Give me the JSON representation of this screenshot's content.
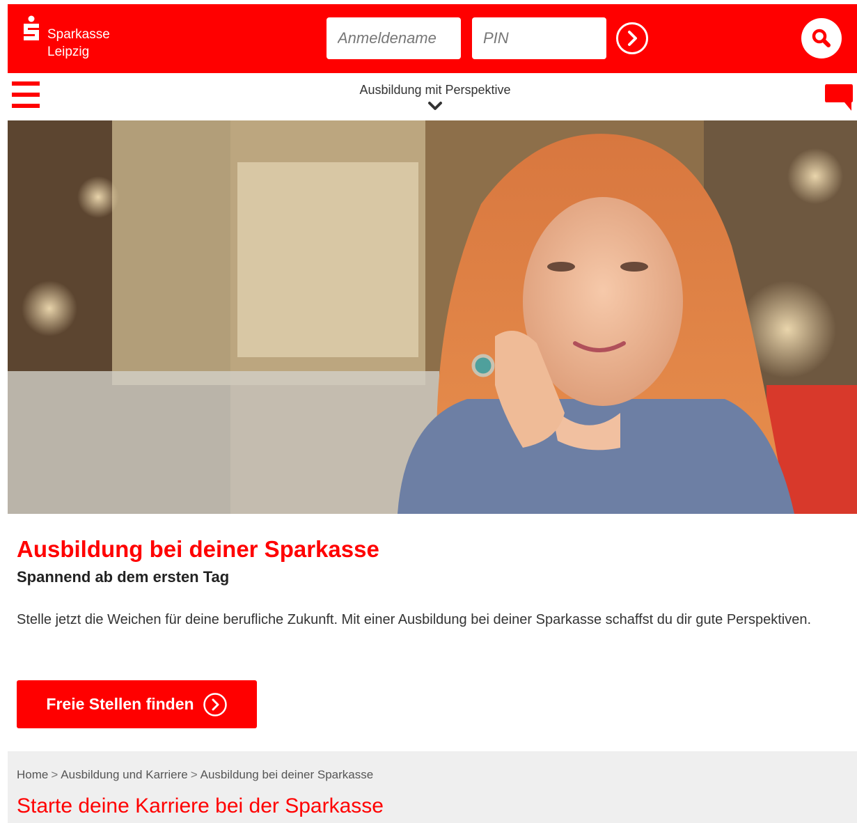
{
  "brand": {
    "name_line1": "Sparkasse",
    "name_line2": "Leipzig",
    "color": "#ff0000"
  },
  "login": {
    "username_placeholder": "Anmeldename",
    "pin_placeholder": "PIN",
    "submit_icon": "chevron-right-circle-icon"
  },
  "header": {
    "search_icon": "search-icon"
  },
  "subnav": {
    "menu_icon": "hamburger-menu-icon",
    "title": "Ausbildung mit Perspektive",
    "dropdown_icon": "chevron-down-icon",
    "chat_icon": "chat-bubble-icon"
  },
  "hero": {
    "image": "young woman with red hair resting chin on hand, smiling, blurred cafe background"
  },
  "content": {
    "headline": "Ausbildung bei deiner Sparkasse",
    "subheadline": "Spannend ab dem ersten Tag",
    "intro": "Stelle jetzt die Weichen für deine berufliche Zukunft. Mit einer Ausbildung bei deiner Sparkasse schaffst du dir gute Perspektiven.",
    "cta_label": "Freie Stellen finden"
  },
  "breadcrumb": {
    "items": [
      "Home",
      "Ausbildung und Karriere",
      "Ausbildung bei deiner Sparkasse"
    ],
    "separator": ">"
  },
  "section": {
    "title": "Starte deine Karriere bei der Sparkasse"
  }
}
